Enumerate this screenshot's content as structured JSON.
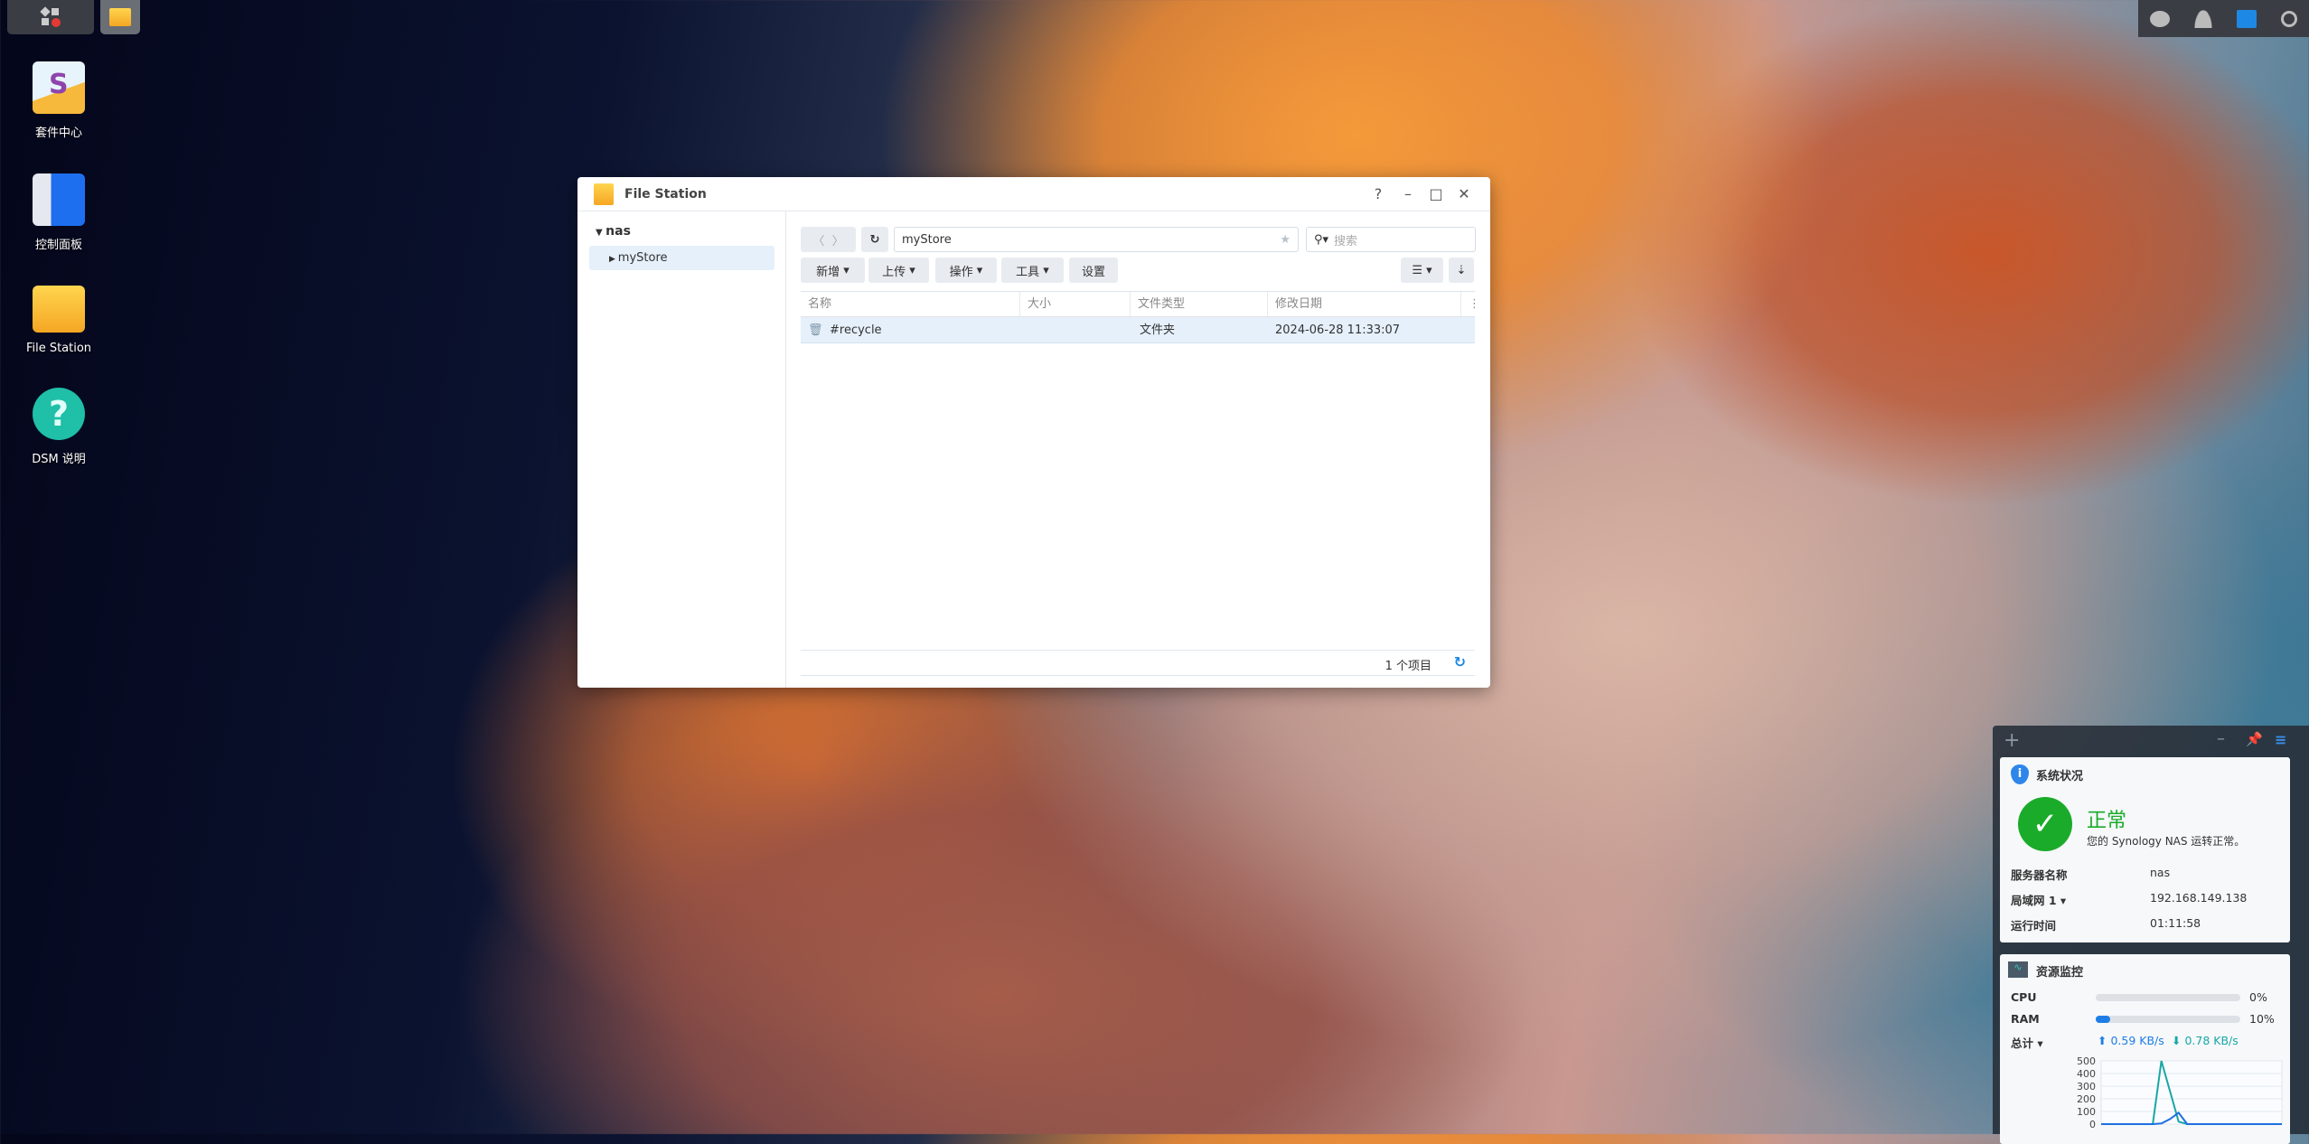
{
  "taskbar": {
    "main_menu_icon": "grid-icon",
    "open_app_icon": "folder-icon"
  },
  "tray": {
    "icons": [
      "chat-icon",
      "user-icon",
      "widgets-icon",
      "search-icon"
    ],
    "accent": "#1e88e5"
  },
  "desktop": [
    {
      "label": "套件中心",
      "icon": "package-center-icon"
    },
    {
      "label": "控制面板",
      "icon": "control-panel-icon"
    },
    {
      "label": "File Station",
      "icon": "folder-icon"
    },
    {
      "label": "DSM 说明",
      "icon": "help-icon"
    }
  ],
  "window": {
    "title": "File Station",
    "controls": [
      "?",
      "–",
      "□",
      "✕"
    ],
    "tree": {
      "root": "nas",
      "child": "myStore"
    },
    "path": "myStore",
    "search_placeholder": "搜索",
    "toolbar": [
      "新增",
      "上传",
      "操作",
      "工具",
      "设置"
    ],
    "columns": [
      "名称",
      "大小",
      "文件类型",
      "修改日期"
    ],
    "rows": [
      {
        "name": "#recycle",
        "size": "",
        "type": "文件夹",
        "date": "2024-06-28 11:33:07"
      }
    ],
    "footer": "1 个项目"
  },
  "widgets": {
    "status": {
      "title": "系统状况",
      "state": "正常",
      "message": "您的 Synology NAS 运转正常。",
      "rows": [
        {
          "k": "服务器名称",
          "v": "nas"
        },
        {
          "k": "局域网 1 ▾",
          "v": "192.168.149.138"
        },
        {
          "k": "运行时间",
          "v": "01:11:58"
        }
      ]
    },
    "resource": {
      "title": "资源监控",
      "cpu_label": "CPU",
      "cpu": "0%",
      "cpu_value": 0,
      "ram_label": "RAM",
      "ram": "10%",
      "ram_value": 10,
      "total_label": "总计 ▾",
      "up": "0.59 KB/s",
      "down": "0.78 KB/s"
    }
  },
  "chart_data": {
    "type": "line",
    "ylim": [
      0,
      500
    ],
    "yticks": [
      "500",
      "400",
      "300",
      "200",
      "100",
      "0"
    ],
    "series": [
      {
        "color": "#1aa6a6",
        "values": [
          0,
          0,
          0,
          0,
          0,
          0,
          0,
          500,
          260,
          20,
          0,
          0,
          0,
          0,
          0,
          0,
          0,
          0,
          0,
          0,
          0,
          0
        ]
      },
      {
        "color": "#1e6fe0",
        "values": [
          0,
          0,
          0,
          0,
          0,
          0,
          0,
          5,
          40,
          90,
          0,
          0,
          0,
          0,
          0,
          0,
          0,
          0,
          0,
          0,
          0,
          0
        ]
      }
    ]
  }
}
